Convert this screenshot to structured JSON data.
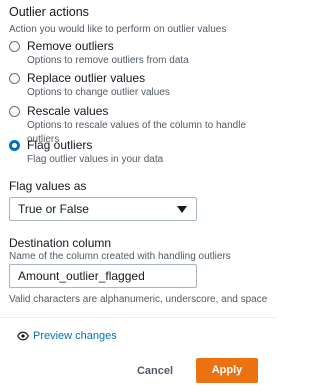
{
  "outlier_actions": {
    "title": "Outlier actions",
    "description": "Action you would like to perform on outlier values",
    "options": [
      {
        "label": "Remove outliers",
        "desc": "Options to remove outliers from data",
        "checked": false
      },
      {
        "label": "Replace outlier values",
        "desc": "Options to change outlier values",
        "checked": false
      },
      {
        "label": "Rescale values",
        "desc": "Options to rescale values of the column to handle outliers",
        "checked": false
      },
      {
        "label": "Flag outliers",
        "desc": "Flag outlier values in your data",
        "checked": true
      }
    ]
  },
  "flag_values": {
    "label": "Flag values as",
    "selected": "True or False"
  },
  "destination": {
    "label": "Destination column",
    "desc": "Name of the column created with handling outliers",
    "value": "Amount_outlier_flagged",
    "helper": "Valid characters are alphanumeric, underscore, and space"
  },
  "preview": {
    "label": "Preview changes"
  },
  "footer": {
    "cancel_label": "Cancel",
    "apply_label": "Apply"
  },
  "colors": {
    "accent": "#0073bb",
    "primary_button": "#ec7211"
  }
}
